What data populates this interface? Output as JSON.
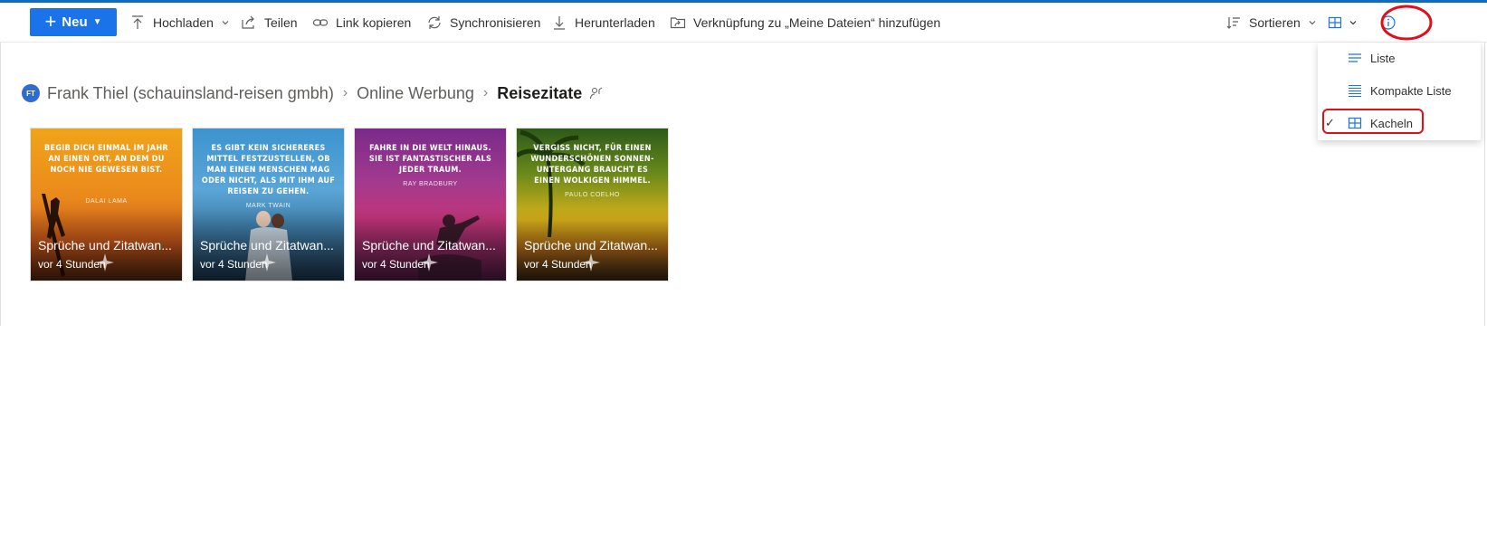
{
  "toolbar": {
    "new_label": "Neu",
    "upload_label": "Hochladen",
    "share_label": "Teilen",
    "copy_link_label": "Link kopieren",
    "sync_label": "Synchronisieren",
    "download_label": "Herunterladen",
    "shortcut_label": "Verknüpfung zu „Meine Dateien“ hinzufügen",
    "sort_label": "Sortieren"
  },
  "breadcrumb": {
    "avatar_initials": "FT",
    "items": [
      "Frank Thiel (schauinsland-reisen gmbh)",
      "Online Werbung",
      "Reisezitate"
    ]
  },
  "tiles": [
    {
      "quote": "BEGIB DICH EINMAL IM JAHR AN EINEN ORT, AN DEM DU NOCH NIE GEWESEN BIST.",
      "author": "DALAI LAMA",
      "name": "Sprüche und Zitatwan...",
      "time": "vor 4 Stunden"
    },
    {
      "quote": "ES GIBT KEIN SICHERERES MITTEL FESTZUSTELLEN, OB MAN EINEN MENSCHEN MAG ODER NICHT, ALS MIT IHM AUF REISEN ZU GEHEN.",
      "author": "MARK TWAIN",
      "name": "Sprüche und Zitatwan...",
      "time": "vor 4 Stunden"
    },
    {
      "quote": "FAHRE IN DIE WELT HINAUS. SIE IST FANTASTISCHER ALS JEDER TRAUM.",
      "author": "RAY BRADBURY",
      "name": "Sprüche und Zitatwan...",
      "time": "vor 4 Stunden"
    },
    {
      "quote": "VERGISS NICHT, FÜR EINEN WUNDERSCHÖNEN SONNEN-UNTERGANG BRAUCHT ES EINEN WOLKIGEN HIMMEL.",
      "author": "PAULO COELHO",
      "name": "Sprüche und Zitatwan...",
      "time": "vor 4 Stunden"
    }
  ],
  "view_menu": {
    "items": [
      {
        "label": "Liste",
        "icon": "list-icon",
        "checked": false
      },
      {
        "label": "Kompakte Liste",
        "icon": "compact-list-icon",
        "checked": false
      },
      {
        "label": "Kacheln",
        "icon": "tiles-icon",
        "checked": true
      }
    ],
    "check_glyph": "✓"
  },
  "colors": {
    "accent": "#1a73e8",
    "highlight": "#e0101b"
  }
}
